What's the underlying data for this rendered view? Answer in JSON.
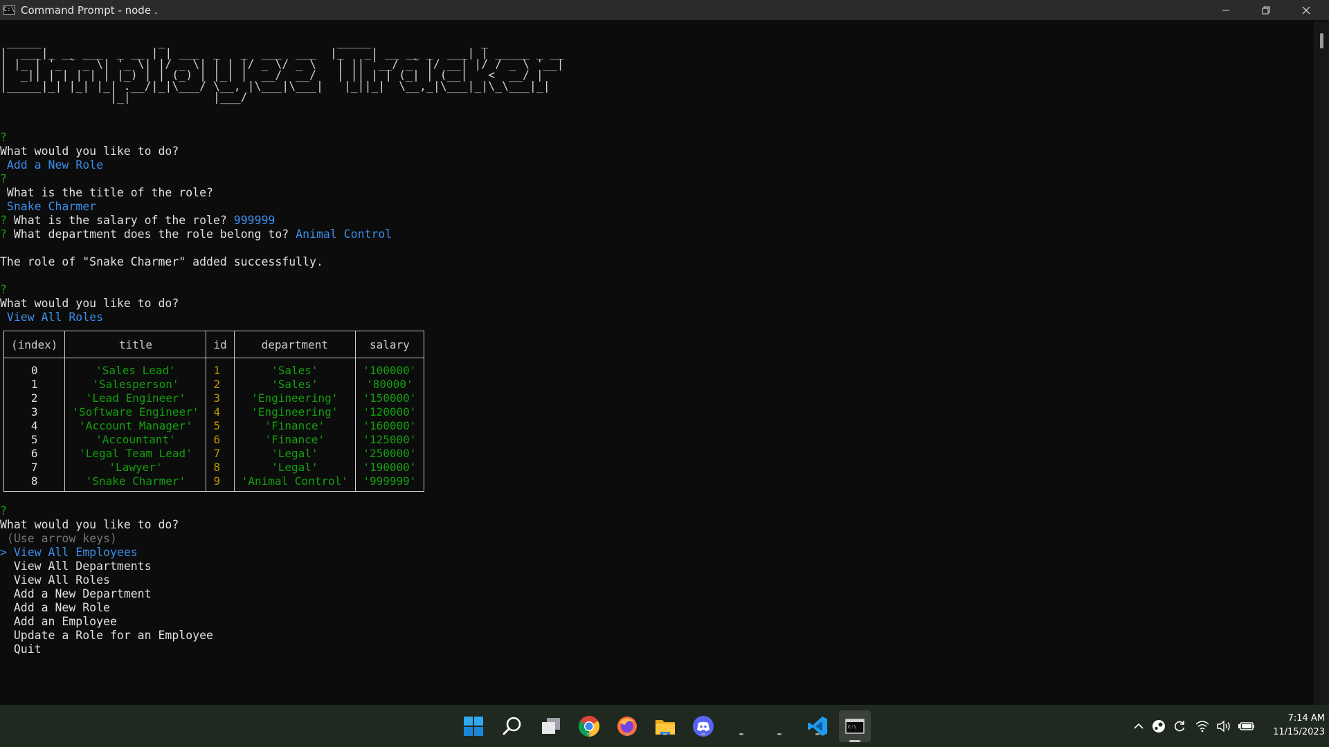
{
  "window": {
    "title": "Command Prompt - node .",
    "app_icon_text": "C:\\"
  },
  "terminal": {
    "banner_text": " _____                 _                         _____                _\n|  ___|_ __ ___  _ __ | | ___  _   _  ___  ___  |_   _| __ __ _  ___| | _____ _ __\n| |_ | '_ ` _ \\| '_ \\| |/ _ \\| | | |/ _ \\/ _ \\   | || '__/ _` |/ __| |/ / _ \\ '__|\n|  _|| | | | | | |_) | | (_) | |_| |  __/  __/   | || | | (_| | (__|   <  __/ |\n|_____|_| |_| |_| .__/|_|\\___/ \\__, |\\___|\\___|   |_||_|  \\__,_|\\___|_|\\_\\___|_|\n                |_|            |___/",
    "q_mark": "?",
    "prompt_what_to_do": "What would you like to do?",
    "answer_add_role": " Add a New Role",
    "prompt_title": " What is the title of the role?",
    "answer_title": " Snake Charmer",
    "prompt_salary": " What is the salary of the role?",
    "answer_salary": "999999",
    "prompt_department": " What department does the role belong to?",
    "answer_department": "Animal Control",
    "success_message": "The role of \"Snake Charmer\" added successfully.",
    "answer_view_roles": " View All Roles",
    "hint_arrow_keys": " (Use arrow keys)",
    "pointer": ">",
    "menu": [
      {
        "label": "View All Employees",
        "selected": true
      },
      {
        "label": "View All Departments",
        "selected": false
      },
      {
        "label": "View All Roles",
        "selected": false
      },
      {
        "label": "Add a New Department",
        "selected": false
      },
      {
        "label": "Add a New Role",
        "selected": false
      },
      {
        "label": "Add an Employee",
        "selected": false
      },
      {
        "label": "Update a Role for an Employee",
        "selected": false
      },
      {
        "label": "Quit",
        "selected": false
      }
    ]
  },
  "roles_table": {
    "headers": [
      "(index)",
      "title",
      "id",
      "department",
      "salary"
    ],
    "rows": [
      [
        "0",
        "'Sales Lead'",
        "1",
        "'Sales'",
        "'100000'"
      ],
      [
        "1",
        "'Salesperson'",
        "2",
        "'Sales'",
        "'80000'"
      ],
      [
        "2",
        "'Lead Engineer'",
        "3",
        "'Engineering'",
        "'150000'"
      ],
      [
        "3",
        "'Software Engineer'",
        "4",
        "'Engineering'",
        "'120000'"
      ],
      [
        "4",
        "'Account Manager'",
        "5",
        "'Finance'",
        "'160000'"
      ],
      [
        "5",
        "'Accountant'",
        "6",
        "'Finance'",
        "'125000'"
      ],
      [
        "6",
        "'Legal Team Lead'",
        "7",
        "'Legal'",
        "'250000'"
      ],
      [
        "7",
        "'Lawyer'",
        "8",
        "'Legal'",
        "'190000'"
      ],
      [
        "8",
        "'Snake Charmer'",
        "9",
        "'Animal Control'",
        "'999999'"
      ]
    ]
  },
  "taskbar": {
    "apps": [
      "start-icon",
      "search-icon",
      "task-view-icon",
      "chrome-icon",
      "firefox-icon",
      "file-explorer-icon",
      "discord-icon",
      "app-icon-1",
      "app-icon-2",
      "vscode-icon",
      "terminal-icon"
    ],
    "clock_time": "7:14 AM",
    "clock_date": "11/15/2023"
  },
  "colors": {
    "prompt_green": "#13a10e",
    "answer_blue": "#3b8eea",
    "number_orange": "#c19c00",
    "terminal_bg": "#0c0c0c",
    "taskbar_bg": "#20291f"
  }
}
